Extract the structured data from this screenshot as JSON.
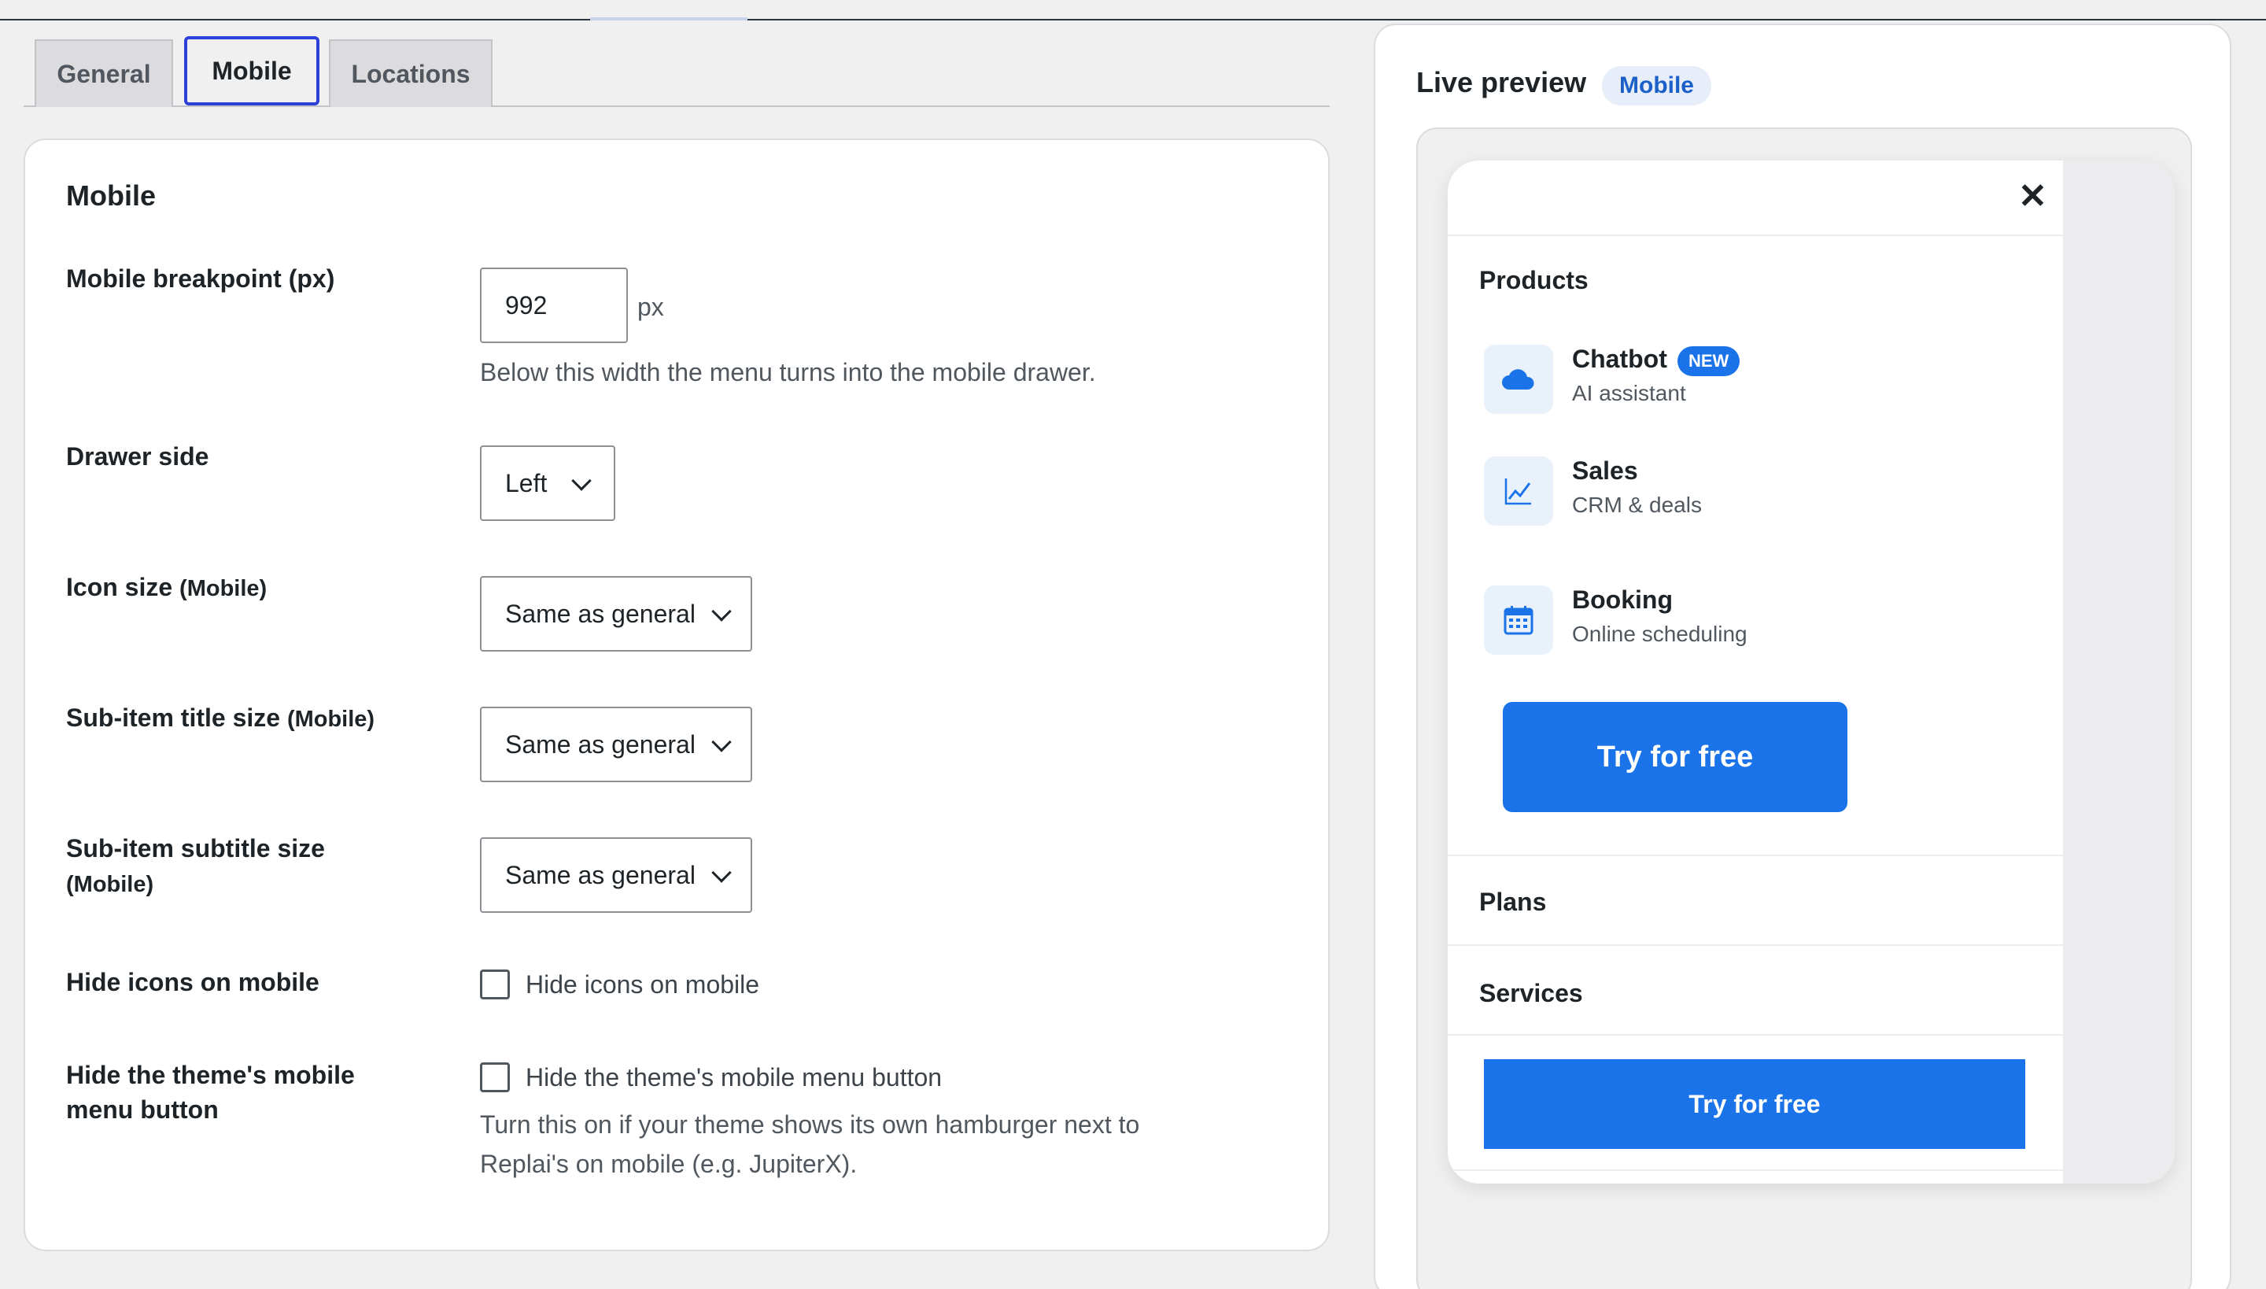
{
  "tabs": [
    {
      "label": "General"
    },
    {
      "label": "Mobile"
    },
    {
      "label": "Locations"
    }
  ],
  "settings": {
    "title": "Mobile",
    "breakpoint": {
      "label": "Mobile breakpoint (px)",
      "value": "992",
      "unit": "px",
      "help": "Below this width the menu turns into the mobile drawer."
    },
    "drawer_side": {
      "label": "Drawer side",
      "value": "Left"
    },
    "icon_size": {
      "label": "Icon size",
      "suffix": "(Mobile)",
      "value": "Same as general"
    },
    "subitem_title_size": {
      "label": "Sub-item title size",
      "suffix": "(Mobile)",
      "value": "Same as general"
    },
    "subitem_subtitle_size": {
      "label": "Sub-item subtitle size",
      "suffix": "(Mobile)",
      "value": "Same as general"
    },
    "hide_icons": {
      "label": "Hide icons on mobile",
      "checkbox_label": "Hide icons on mobile",
      "checked": false
    },
    "hide_theme_button": {
      "label": "Hide the theme's mobile menu button",
      "checkbox_label": "Hide the theme's mobile menu button",
      "checked": false,
      "help": "Turn this on if your theme shows its own hamburger next to Replai's on mobile (e.g. JupiterX)."
    }
  },
  "preview": {
    "title": "Live preview",
    "badge": "Mobile",
    "close_icon": "close-icon",
    "products_label": "Products",
    "items": [
      {
        "title": "Chatbot",
        "subtitle": "AI assistant",
        "badge": "NEW",
        "icon": "cloud-icon"
      },
      {
        "title": "Sales",
        "subtitle": "CRM & deals",
        "icon": "chart-line-icon"
      },
      {
        "title": "Booking",
        "subtitle": "Online scheduling",
        "icon": "calendar-icon"
      }
    ],
    "cta_primary": "Try for free",
    "plans_label": "Plans",
    "services_label": "Services",
    "cta_bottom": "Try for free",
    "accent_color": "#1a73e8"
  }
}
